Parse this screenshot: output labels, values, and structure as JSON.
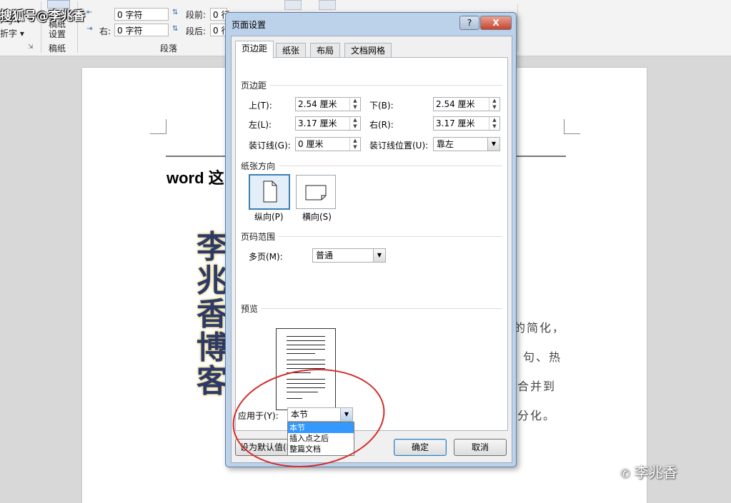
{
  "watermark_top": "搜狐号@李兆香",
  "ribbon": {
    "left_fragment_1": "F号 ▾",
    "left_fragment_2": "折字 ▾",
    "gaozhi_button_label_1": "稿纸",
    "gaozhi_button_label_2": "设置",
    "group_gaozhi": "稿纸",
    "indent_left_label": "左:",
    "indent_left_value": "0 字符",
    "indent_right_label": "右:",
    "indent_right_value": "0 字符",
    "spacing_before_label": "段前:",
    "spacing_before_value": "0 行",
    "spacing_after_label": "段后:",
    "spacing_after_value": "0 行",
    "group_paragraph": "段落"
  },
  "document": {
    "title_fragment": "word 这",
    "vertical_art": [
      "李",
      "兆",
      "香",
      "博",
      "客"
    ],
    "body_fragments": [
      "的简化，",
      "句、热",
      "合并到",
      "分化。"
    ]
  },
  "watermark_bottom": "李兆香",
  "dialog": {
    "title": "页面设置",
    "help_button": "?",
    "close_button": "X",
    "tabs": [
      {
        "label": "页边距",
        "active": true
      },
      {
        "label": "纸张",
        "active": false
      },
      {
        "label": "布局",
        "active": false
      },
      {
        "label": "文档网格",
        "active": false
      }
    ],
    "margins": {
      "group_label": "页边距",
      "top_label": "上(T):",
      "top_value": "2.54 厘米",
      "bottom_label": "下(B):",
      "bottom_value": "2.54 厘米",
      "left_label": "左(L):",
      "left_value": "3.17 厘米",
      "right_label": "右(R):",
      "right_value": "3.17 厘米",
      "gutter_label": "装订线(G):",
      "gutter_value": "0 厘米",
      "gutter_pos_label": "装订线位置(U):",
      "gutter_pos_value": "靠左"
    },
    "orientation": {
      "group_label": "纸张方向",
      "portrait_label": "纵向(P)",
      "landscape_label": "横向(S)",
      "selected": "portrait"
    },
    "pages": {
      "group_label": "页码范围",
      "multiple_label": "多页(M):",
      "multiple_value": "普通"
    },
    "preview": {
      "group_label": "预览",
      "apply_label": "应用于(Y):",
      "apply_value": "本节",
      "apply_options": [
        "本节",
        "插入点之后",
        "整篇文档"
      ],
      "apply_highlighted": 0
    },
    "buttons": {
      "set_default": "设为默认值(D)",
      "ok": "确定",
      "cancel": "取消"
    }
  },
  "colors": {
    "dialog_frame": "#bcd2ea",
    "annotation_circle": "#d42b2b",
    "selection": "#3399ff"
  }
}
